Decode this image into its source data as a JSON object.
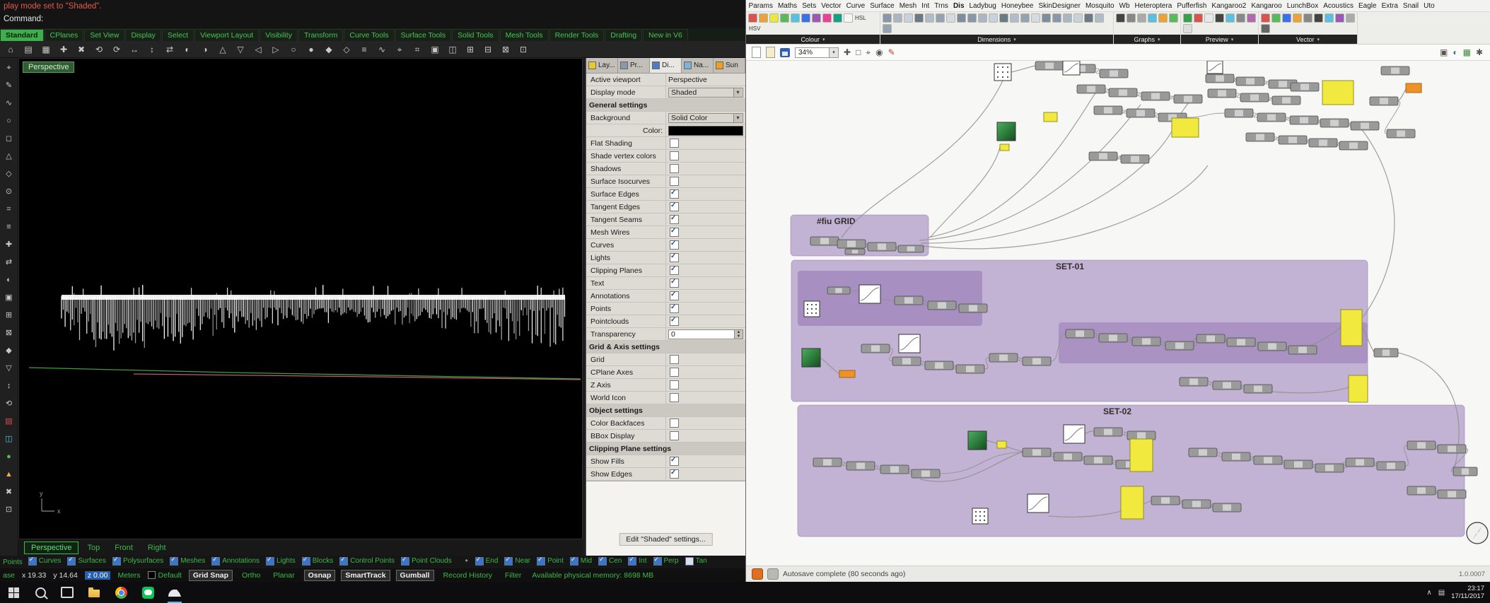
{
  "rhino": {
    "command": {
      "history": "play mode set to \"Shaded\".",
      "prompt": "Command:"
    },
    "toolbar_tabs": [
      "Standard",
      "CPlanes",
      "Set View",
      "Display",
      "Select",
      "Viewport Layout",
      "Visibility",
      "Transform",
      "Curve Tools",
      "Surface Tools",
      "Solid Tools",
      "Mesh Tools",
      "Render Tools",
      "Drafting",
      "New in V6"
    ],
    "active_toolbar_tab": "Standard",
    "viewport": {
      "label": "Perspective",
      "axis_x_label": "x",
      "axis_y_label": "y"
    },
    "viewport_tabs": [
      {
        "label": "Perspective",
        "active": true
      },
      {
        "label": "Top",
        "active": false
      },
      {
        "label": "Front",
        "active": false
      },
      {
        "label": "Right",
        "active": false
      }
    ],
    "panel": {
      "tabs": [
        {
          "label": "Lay...",
          "color": "#e8c931",
          "active": false
        },
        {
          "label": "Pr...",
          "color": "#8899aa",
          "active": false
        },
        {
          "label": "Di...",
          "color": "#4f7fc2",
          "active": true
        },
        {
          "label": "Na...",
          "color": "#7fb2d8",
          "active": false
        },
        {
          "label": "Sun",
          "color": "#f0a020",
          "active": false
        }
      ],
      "rows": [
        {
          "type": "field",
          "label": "Active viewport",
          "value": "Perspective",
          "control": "text"
        },
        {
          "type": "field",
          "label": "Display mode",
          "value": "Shaded",
          "control": "dropdown"
        },
        {
          "type": "header",
          "label": "General settings"
        },
        {
          "type": "field",
          "label": "Background",
          "value": "Solid Color",
          "control": "dropdown"
        },
        {
          "type": "color",
          "label": "Color:",
          "value": "#000000"
        },
        {
          "type": "check",
          "label": "Flat Shading",
          "checked": false
        },
        {
          "type": "check",
          "label": "Shade vertex colors",
          "checked": false
        },
        {
          "type": "check",
          "label": "Shadows",
          "checked": false
        },
        {
          "type": "check",
          "label": "Surface Isocurves",
          "checked": false
        },
        {
          "type": "check",
          "label": "Surface Edges",
          "checked": true
        },
        {
          "type": "check",
          "label": "Tangent Edges",
          "checked": true
        },
        {
          "type": "check",
          "label": "Tangent Seams",
          "checked": true
        },
        {
          "type": "check",
          "label": "Mesh Wires",
          "checked": true
        },
        {
          "type": "check",
          "label": "Curves",
          "checked": true
        },
        {
          "type": "check",
          "label": "Lights",
          "checked": true
        },
        {
          "type": "check",
          "label": "Clipping Planes",
          "checked": true
        },
        {
          "type": "check",
          "label": "Text",
          "checked": true
        },
        {
          "type": "check",
          "label": "Annotations",
          "checked": true
        },
        {
          "type": "check",
          "label": "Points",
          "checked": true
        },
        {
          "type": "check",
          "label": "Pointclouds",
          "checked": true
        },
        {
          "type": "spinner",
          "label": "Transparency",
          "value": "0"
        },
        {
          "type": "header",
          "label": "Grid & Axis settings"
        },
        {
          "type": "check",
          "label": "Grid",
          "checked": false
        },
        {
          "type": "check",
          "label": "CPlane Axes",
          "checked": false
        },
        {
          "type": "check",
          "label": "Z Axis",
          "checked": false
        },
        {
          "type": "check",
          "label": "World Icon",
          "checked": false
        },
        {
          "type": "header",
          "label": "Object settings"
        },
        {
          "type": "check",
          "label": "Color Backfaces",
          "checked": false
        },
        {
          "type": "check",
          "label": "BBox Display",
          "checked": false
        },
        {
          "type": "header",
          "label": "Clipping Plane settings"
        },
        {
          "type": "check",
          "label": "Show Fills",
          "checked": true
        },
        {
          "type": "check",
          "label": "Show Edges",
          "checked": true
        }
      ],
      "edit_button": "Edit \"Shaded\" settings..."
    },
    "filter_bar": {
      "lead": "Points",
      "filters": [
        {
          "label": "Curves",
          "checked": true
        },
        {
          "label": "Surfaces",
          "checked": true
        },
        {
          "label": "Polysurfaces",
          "checked": true
        },
        {
          "label": "Meshes",
          "checked": true
        },
        {
          "label": "Annotations",
          "checked": true
        },
        {
          "label": "Lights",
          "checked": true
        },
        {
          "label": "Blocks",
          "checked": true
        },
        {
          "label": "Control Points",
          "checked": true
        },
        {
          "label": "Point Clouds",
          "checked": true
        }
      ],
      "osnap_lead": "*",
      "osnaps": [
        {
          "label": "End",
          "checked": true
        },
        {
          "label": "Near",
          "checked": true
        },
        {
          "label": "Point",
          "checked": true
        },
        {
          "label": "Mid",
          "checked": true
        },
        {
          "label": "Cen",
          "checked": true
        },
        {
          "label": "Int",
          "checked": true
        },
        {
          "label": "Perp",
          "checked": true
        },
        {
          "label": "Tan",
          "checked": false
        }
      ]
    },
    "status_bar": {
      "cplane": "ase",
      "coords": {
        "x": "x 19.33",
        "y": "y 14.64",
        "z": "z 0.00"
      },
      "units": "Meters",
      "layer": "Default",
      "toggles": [
        {
          "label": "Grid Snap",
          "active": true
        },
        {
          "label": "Ortho",
          "active": false
        },
        {
          "label": "Planar",
          "active": false
        },
        {
          "label": "Osnap",
          "active": true
        },
        {
          "label": "SmartTrack",
          "active": true
        },
        {
          "label": "Gumball",
          "active": true
        },
        {
          "label": "Record History",
          "active": false
        },
        {
          "label": "Filter",
          "active": false
        }
      ],
      "memory": "Available physical memory: 8698 MB"
    }
  },
  "grasshopper": {
    "menu_tabs": [
      "Params",
      "Maths",
      "Sets",
      "Vector",
      "Curve",
      "Surface",
      "Mesh",
      "Int",
      "Trns",
      "Dis",
      "Ladybug",
      "Honeybee",
      "SkinDesigner",
      "Mosquito",
      "Wb",
      "Heteroptera",
      "Pufferfish",
      "Kangaroo2",
      "Kangaroo",
      "LunchBox",
      "Acoustics",
      "Eagle",
      "Extra",
      "Snail",
      "Uto"
    ],
    "active_menu_tab": "Dis",
    "ribbon_groups": [
      {
        "label": "Colour"
      },
      {
        "label": "Dimensions"
      },
      {
        "label": "Graphs"
      },
      {
        "label": "Preview"
      },
      {
        "label": "Vector"
      }
    ],
    "ribbon_captions": [
      "HSL",
      "HSV"
    ],
    "zoom_value": "34%",
    "canvas_groups": [
      {
        "label": "#fiu GRID"
      },
      {
        "label": "SET-01"
      },
      {
        "label": "SET-02"
      }
    ],
    "status_text": "Autosave complete (80 seconds ago)",
    "version": "1.0.0007",
    "colors": {
      "group_fill": "#b6a2cc",
      "panel_yellow": "#f2e93e",
      "panel_orange": "#ef9226"
    }
  },
  "taskbar": {
    "clock_time": "23:17",
    "clock_date": "17/11/2017"
  }
}
